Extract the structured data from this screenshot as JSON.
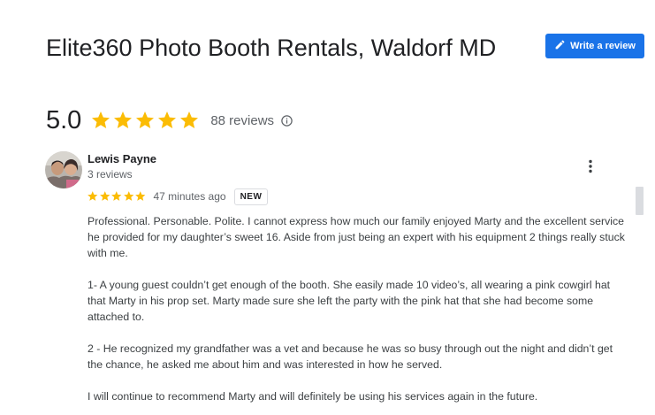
{
  "place": {
    "title": "Elite360 Photo Booth Rentals, Waldorf MD",
    "rating": "5.0",
    "star_count": 5,
    "reviews_label": "88 reviews"
  },
  "actions": {
    "write_review_label": "Write a review"
  },
  "review": {
    "author": "Lewis Payne",
    "author_reviews": "3 reviews",
    "star_rating": 5,
    "time": "47 minutes ago",
    "badge": "NEW",
    "paragraphs": [
      "Professional. Personable. Polite. I cannot express how much our family enjoyed Marty and the excellent service he provided for my daughter’s sweet 16. Aside from just being an expert with his equipment 2 things really stuck with me.",
      "1- A young guest couldn’t get enough of the booth. She easily made 10 video’s, all wearing a pink cowgirl hat that Marty in his prop set. Marty made sure she left the party with the pink hat that she had become some attached to.",
      "2 - He recognized my grandfather was a vet and because he was so busy through out the night and didn’t get the chance, he asked me about him and was interested in how he served.",
      "I will continue to recommend Marty and will definitely be using his services again in the future."
    ]
  },
  "colors": {
    "star": "#fbbc04",
    "button": "#1a73e8"
  },
  "icons": {
    "write": "pencil-icon",
    "info": "info-icon",
    "more": "more-vert-icon",
    "star": "star-icon"
  }
}
